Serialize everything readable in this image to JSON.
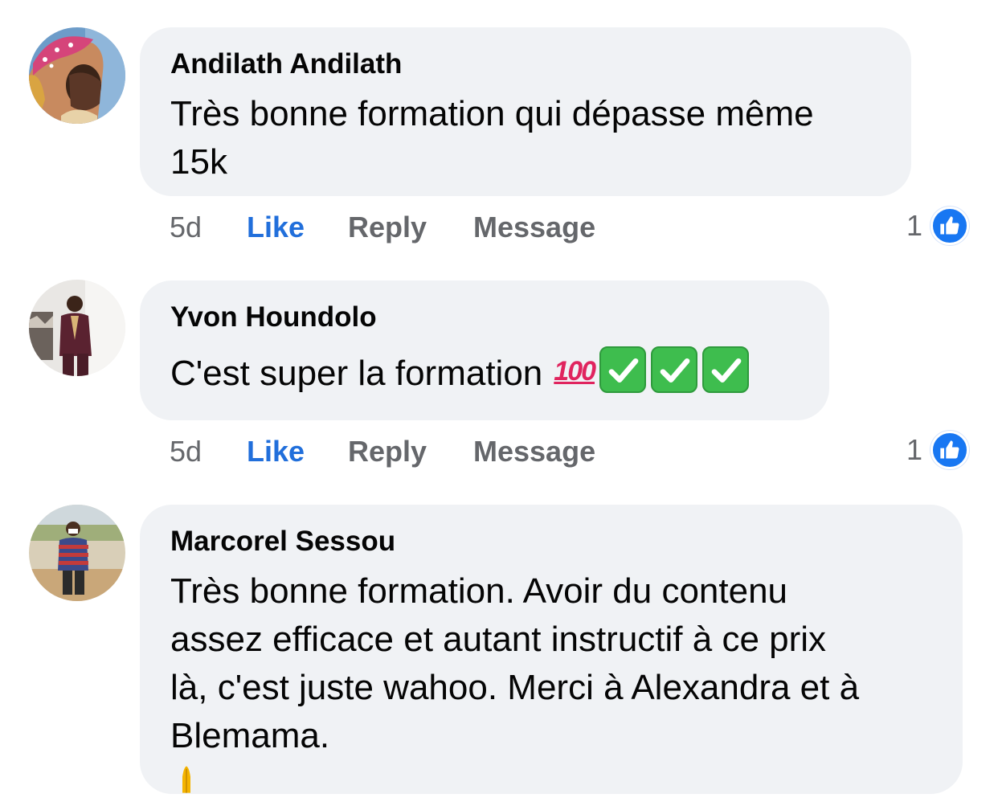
{
  "comments": [
    {
      "author": "Andilath Andilath",
      "text": "Très bonne formation qui dépasse même\n15k",
      "time": "5d",
      "like": "Like",
      "reply": "Reply",
      "message": "Message",
      "reaction_count": "1",
      "avatar_icon": "profile-photo-woman-pink-headscarf"
    },
    {
      "author": "Yvon Houndolo",
      "text": "C'est super la formation",
      "emoji": "💯",
      "checks": [
        "check-mark-button-icon",
        "check-mark-button-icon",
        "check-mark-button-icon"
      ],
      "time": "5d",
      "like": "Like",
      "reply": "Reply",
      "message": "Message",
      "reaction_count": "1",
      "avatar_icon": "profile-photo-man-burgundy-outfit"
    },
    {
      "author": "Marcorel Sessou",
      "text": "Très bonne formation. Avoir du contenu\nassez efficace et autant instructif à ce prix\nlà, c'est juste wahoo. Merci à Alexandra et à\nBlemama.",
      "trailing_emoji_icon": "folded-hands-icon",
      "avatar_icon": "profile-photo-man-striped-shirt"
    }
  ],
  "colors": {
    "bubble": "#f0f2f5",
    "like_active": "#216fdb",
    "meta_gray": "#65676b",
    "like_badge": "#1877f2",
    "check_green": "#3ebd4e"
  }
}
